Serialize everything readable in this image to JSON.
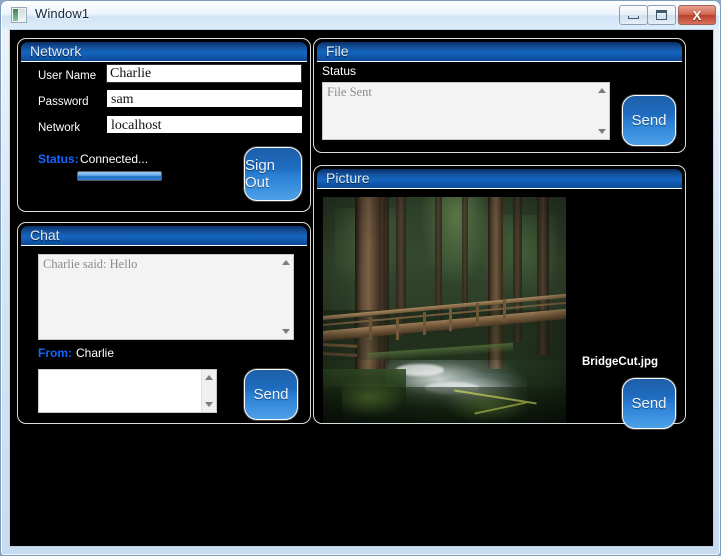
{
  "window": {
    "title": "Window1",
    "icon": "app-window-icon",
    "buttons": {
      "minimize": "minimize",
      "maximize": "maximize",
      "close": "X"
    }
  },
  "network_panel": {
    "caption": "Network",
    "fields": [
      {
        "label": "User Name",
        "value": "Charlie",
        "focused": true
      },
      {
        "label": "Password",
        "value": "sam",
        "focused": false
      },
      {
        "label": "Network",
        "value": "localhost",
        "focused": false
      }
    ],
    "status_label": "Status:",
    "status_value": "Connected...",
    "progress_percent": 100,
    "sign_out_label": "Sign Out"
  },
  "chat_panel": {
    "caption": "Chat",
    "history": "Charlie said: Hello",
    "from_label": "From:",
    "from_value": "Charlie",
    "compose_value": "",
    "send_label": "Send"
  },
  "file_panel": {
    "caption": "File",
    "status_label": "Status",
    "status_text": "File Sent",
    "send_label": "Send"
  },
  "picture_panel": {
    "caption": "Picture",
    "file_name": "BridgeCut.jpg",
    "send_label": "Send",
    "image_description": "Forest footbridge over a creek with tall evergreen trees"
  },
  "colors": {
    "header_blue": "#1565c0",
    "accent_blue": "#1565ff",
    "button_blue": "#2a7fd4",
    "canvas_black": "#000000",
    "field_white": "#ffffff",
    "titlebar_light": "#e8f2fc",
    "close_red": "#b8402c"
  }
}
